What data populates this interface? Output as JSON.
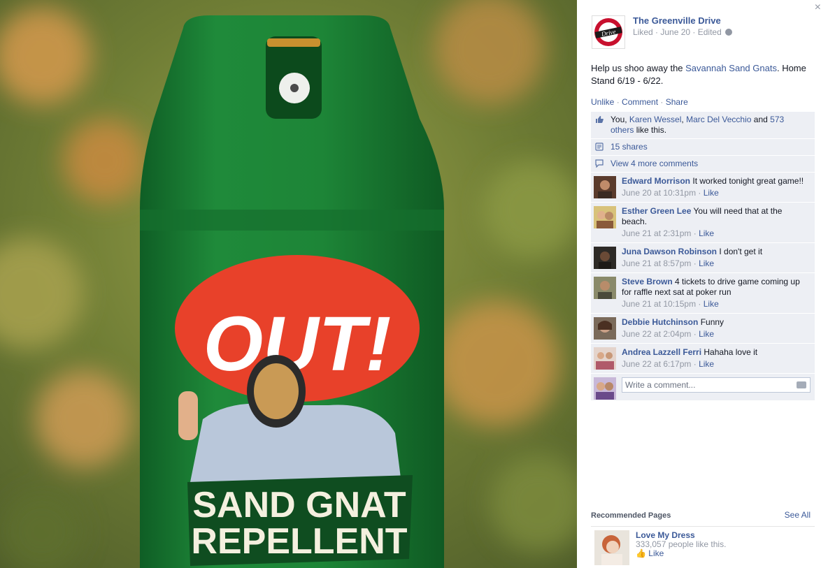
{
  "photo": {
    "cap_logo": "OUT!",
    "product_line1": "SAND GNAT",
    "product_line2": "REPELLENT"
  },
  "panel": {
    "close_glyph": "×",
    "page_name": "The Greenville Drive",
    "logo_text": "Drive",
    "meta": "Liked · June 20 · Edited",
    "post_text_before": "Help us shoo away the ",
    "post_link": "Savannah Sand Gnats",
    "post_text_after": ". Home Stand 6/19 - 6/22.",
    "actions": {
      "unlike": "Unlike",
      "comment": "Comment",
      "share": "Share"
    },
    "likes": {
      "you": "You, ",
      "name1": "Karen Wessel",
      "comma": ", ",
      "name2": "Marc Del Vecchio",
      "and": " and ",
      "others": "573 others",
      "tail": " like this."
    },
    "shares": "15 shares",
    "view_more": "View 4 more comments",
    "comments": [
      {
        "author": "Edward Morrison",
        "text": "It worked tonight great game!!",
        "time": "June 20 at 10:31pm",
        "like": "Like"
      },
      {
        "author": "Esther Green Lee",
        "text": "You will need that at the beach.",
        "time": "June 21 at 2:31pm",
        "like": "Like"
      },
      {
        "author": "Juna Dawson Robinson",
        "text": "I don't get it",
        "time": "June 21 at 8:57pm",
        "like": "Like"
      },
      {
        "author": "Steve Brown",
        "text": "4 tickets to drive game coming up for raffle next sat at poker run",
        "time": "June 21 at 10:15pm",
        "like": "Like"
      },
      {
        "author": "Debbie Hutchinson",
        "text": "Funny",
        "time": "June 22 at 2:04pm",
        "like": "Like"
      },
      {
        "author": "Andrea Lazzell Ferri",
        "text": "Hahaha love it",
        "time": "June 22 at 6:17pm",
        "like": "Like"
      }
    ],
    "write_placeholder": "Write a comment...",
    "recommended": {
      "title": "Recommended Pages",
      "see_all": "See All",
      "item_name": "Love My Dress",
      "item_likes": "333,057 people like this.",
      "item_like": "Like"
    }
  },
  "colors": {
    "link": "#3b5998",
    "ufi_bg": "#edeff4",
    "can_green": "#1f8a3a",
    "bubble_red": "#e8412a"
  },
  "icons": [
    "close-icon",
    "globe-icon",
    "thumbs-up-icon",
    "share-icon",
    "comment-icon",
    "camera-icon"
  ]
}
